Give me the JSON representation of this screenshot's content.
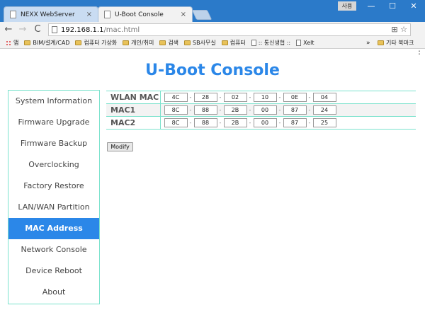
{
  "browser": {
    "tabs": [
      {
        "title": "NEXX WebServer",
        "close": "×"
      },
      {
        "title": "U-Boot Console",
        "close": "×"
      }
    ],
    "user_badge": "사용",
    "window_controls": {
      "minimize": "—",
      "maximize": "☐",
      "close": "✕"
    },
    "address": {
      "host": "192.168.1.1",
      "path": "/mac.html"
    },
    "nav": {
      "back": "←",
      "forward": "→",
      "reload": "C"
    },
    "bookmarks": [
      {
        "label": "앱",
        "icon": "apps-icon"
      },
      {
        "label": "BIM/설계/CAD",
        "icon": "folder-icon"
      },
      {
        "label": "컴퓨터 가상화",
        "icon": "folder-icon"
      },
      {
        "label": "개인/취미",
        "icon": "folder-icon"
      },
      {
        "label": "검색",
        "icon": "folder-icon"
      },
      {
        "label": "SB사무실",
        "icon": "folder-icon"
      },
      {
        "label": "컴퓨터",
        "icon": "folder-icon"
      },
      {
        "label": ":: 통신생협 ::",
        "icon": "page-icon"
      },
      {
        "label": "Xelt",
        "icon": "page-icon"
      }
    ],
    "bookmarks_more": "»",
    "other_bookmarks": "기타 북마크"
  },
  "page": {
    "title": "U-Boot Console",
    "sidebar": [
      {
        "label": "System Information",
        "active": false
      },
      {
        "label": "Firmware Upgrade",
        "active": false
      },
      {
        "label": "Firmware Backup",
        "active": false
      },
      {
        "label": "Overclocking",
        "active": false
      },
      {
        "label": "Factory Restore",
        "active": false
      },
      {
        "label": "LAN/WAN Partition",
        "active": false
      },
      {
        "label": "MAC Address",
        "active": true
      },
      {
        "label": "Network Console",
        "active": false
      },
      {
        "label": "Device Reboot",
        "active": false
      },
      {
        "label": "About",
        "active": false
      }
    ],
    "mac_rows": [
      {
        "label": "WLAN MAC",
        "octets": [
          "4C",
          "28",
          "02",
          "10",
          "0E",
          "04"
        ]
      },
      {
        "label": "MAC1",
        "octets": [
          "8C",
          "88",
          "2B",
          "00",
          "87",
          "24"
        ]
      },
      {
        "label": "MAC2",
        "octets": [
          "8C",
          "88",
          "2B",
          "00",
          "87",
          "25"
        ]
      }
    ],
    "separator": "-",
    "modify_button": "Modify"
  },
  "colors": {
    "accent": "#2b87e8",
    "border": "#7be2cd",
    "chrome": "#2b7ac9"
  }
}
